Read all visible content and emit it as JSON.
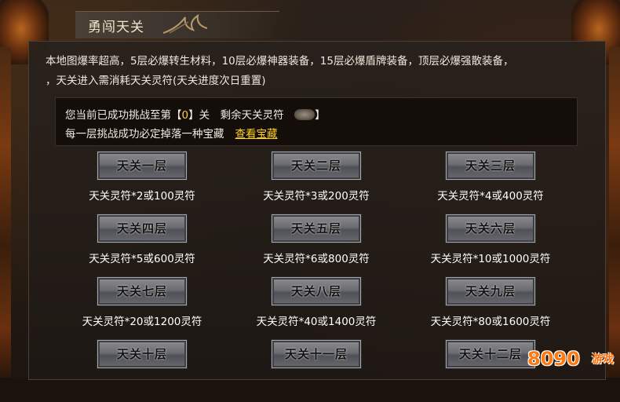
{
  "title": "勇闯天关",
  "intro": {
    "line1": "本地图爆率超高，5层必爆转生材料，10层必爆神器装备，15层必爆盾牌装备，顶层必爆强散装备，",
    "line2": "，天关进入需消耗天关灵符(天关进度次日重置)"
  },
  "status": {
    "progress_prefix": "您当前已成功挑战至第【",
    "progress_value": "0",
    "progress_suffix": "】关　剩余天关灵符",
    "remain_suffix": "】",
    "reward_text": "每一层挑战成功必定掉落一种宝藏",
    "view_treasure_label": "查看宝藏"
  },
  "floors": [
    {
      "label": "天关一层",
      "cost": "天关灵符*2或100灵符"
    },
    {
      "label": "天关二层",
      "cost": "天关灵符*3或200灵符"
    },
    {
      "label": "天关三层",
      "cost": "天关灵符*4或400灵符"
    },
    {
      "label": "天关四层",
      "cost": "天关灵符*5或600灵符"
    },
    {
      "label": "天关五层",
      "cost": "天关灵符*6或800灵符"
    },
    {
      "label": "天关六层",
      "cost": "天关灵符*10或1000灵符"
    },
    {
      "label": "天关七层",
      "cost": "天关灵符*20或1200灵符"
    },
    {
      "label": "天关八层",
      "cost": "天关灵符*40或1400灵符"
    },
    {
      "label": "天关九层",
      "cost": "天关灵符*80或1600灵符"
    },
    {
      "label": "天关十层",
      "cost": ""
    },
    {
      "label": "天关十一层",
      "cost": ""
    },
    {
      "label": "天关十二层",
      "cost": ""
    }
  ],
  "watermark": {
    "text": "8090",
    "cn": "游戏"
  },
  "colors": {
    "accent": "#ffcc33",
    "link": "#ffd020",
    "logo": "#ff7a12"
  }
}
